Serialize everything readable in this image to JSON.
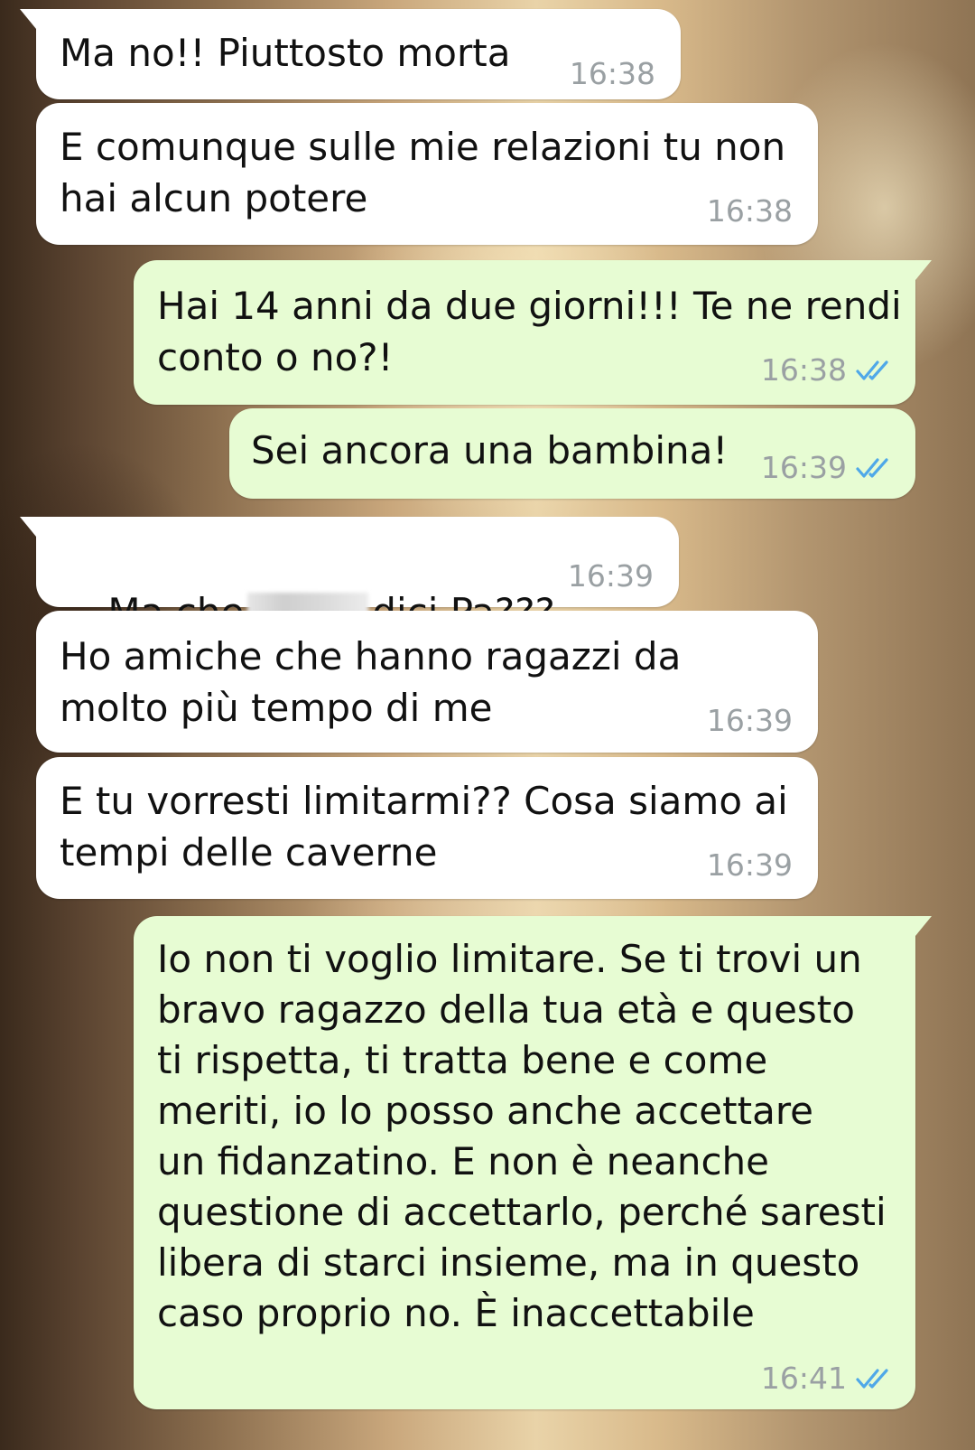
{
  "messages": [
    {
      "dir": "in",
      "text": "Ma no!! Piuttosto morta",
      "time": "16:38"
    },
    {
      "dir": "in",
      "text": "E comunque sulle mie relazioni tu non\nhai alcun potere",
      "time": "16:38"
    },
    {
      "dir": "out",
      "text": "Hai 14 anni da due giorni!!! Te ne rendi\nconto o no?!",
      "time": "16:38",
      "status": "read-double-check-icon"
    },
    {
      "dir": "out",
      "text": "Sei ancora una bambina!",
      "time": "16:39",
      "status": "read-double-check-icon"
    },
    {
      "dir": "in",
      "text_before": "Ma che",
      "text_after": "dici Pa???",
      "redacted": true,
      "time": "16:39"
    },
    {
      "dir": "in",
      "text": "Ho amiche che hanno ragazzi da\nmolto più tempo di me",
      "time": "16:39"
    },
    {
      "dir": "in",
      "text": "E tu vorresti limitarmi?? Cosa siamo ai\ntempi delle caverne",
      "time": "16:39"
    },
    {
      "dir": "out",
      "text": "Io non ti voglio limitare. Se ti trovi un\nbravo ragazzo della tua età e questo\nti rispetta, ti tratta bene e come\nmeriti, io lo posso anche accettare\nun fidanzatino. E non è neanche\nquestione di accettarlo, perché saresti\nlibera di starci insieme, ma in questo\ncaso proprio no. È inaccettabile",
      "time": "16:41",
      "status": "read-double-check-icon"
    }
  ],
  "colors": {
    "incoming_bubble": "#ffffff",
    "outgoing_bubble": "#e7fcd3",
    "read_check": "#4fa8e8",
    "timestamp": "#9aa0a3"
  }
}
